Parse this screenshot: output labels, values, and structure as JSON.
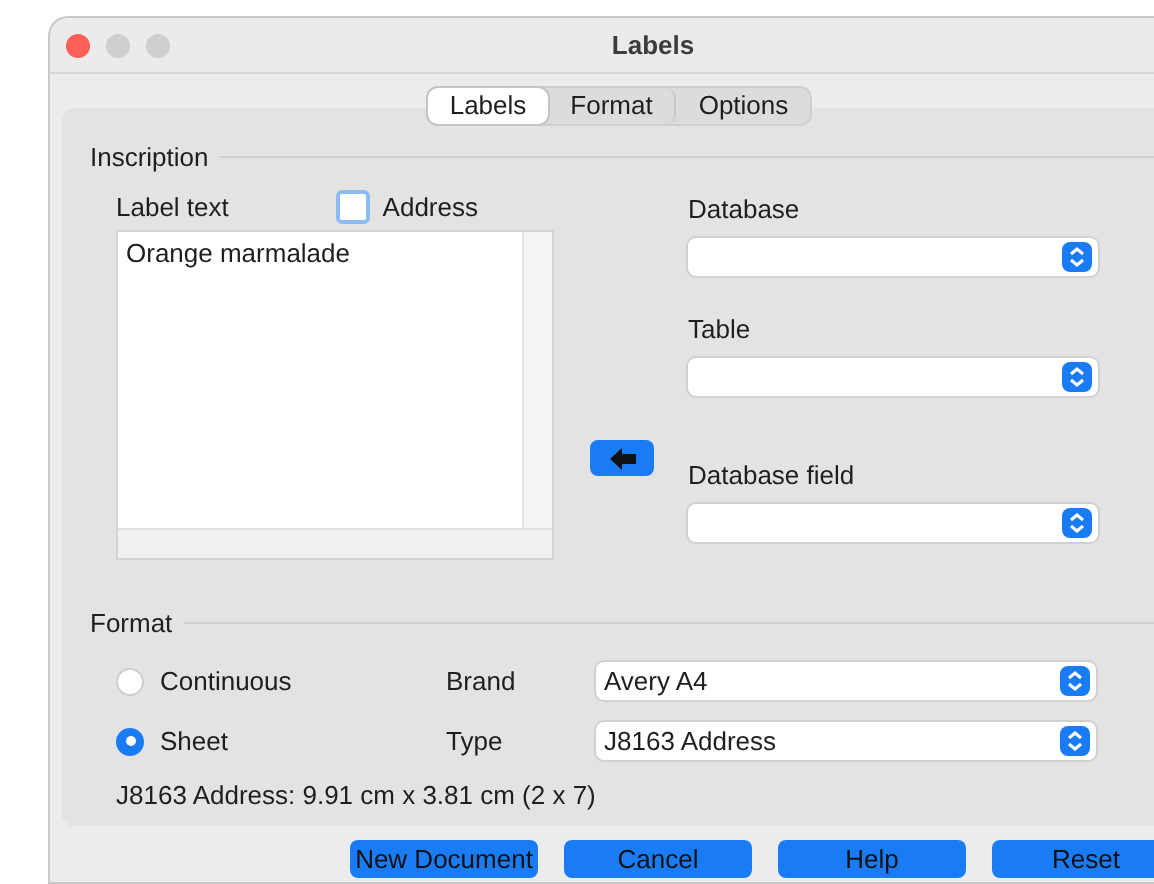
{
  "window": {
    "title": "Labels"
  },
  "tabs": [
    {
      "label": "Labels",
      "selected": true
    },
    {
      "label": "Format",
      "selected": false
    },
    {
      "label": "Options",
      "selected": false
    }
  ],
  "inscription": {
    "title": "Inscription",
    "label_text_label": "Label text",
    "address": {
      "label": "Address",
      "checked": false
    },
    "label_text": "Orange marmalade",
    "fields": [
      {
        "label": "Database"
      },
      {
        "label": "Table"
      },
      {
        "label": "Database field"
      }
    ]
  },
  "format": {
    "title": "Format",
    "options": [
      {
        "label": "Continuous",
        "selected": false
      },
      {
        "label": "Sheet",
        "selected": true
      }
    ],
    "selects": [
      {
        "label": "Brand",
        "value": "Avery A4"
      },
      {
        "label": "Type",
        "value": "J8163 Address"
      }
    ],
    "info": "J8163 Address: 9.91 cm x 3.81 cm (2 x 7)"
  },
  "buttons": [
    "New Document",
    "Cancel",
    "Help",
    "Reset"
  ]
}
